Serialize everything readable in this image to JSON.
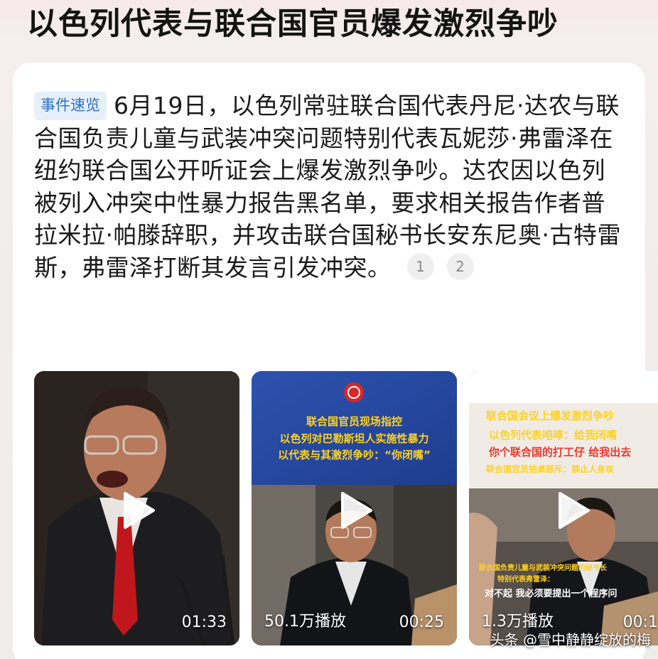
{
  "page": {
    "title": "以色列代表与联合国官员爆发激烈争吵"
  },
  "summary": {
    "tag": "事件速览",
    "text": "6月19日，以色列常驻联合国代表丹尼·达农与联合国负责儿童与武装冲突问题特别代表瓦妮莎·弗雷泽在纽约联合国公开听证会上爆发激烈争吵。达农因以色列被列入冲突中性暴力报告黑名单，要求相关报告作者普拉米拉·帕滕辞职，并攻击联合国秘书长安东尼奥·古特雷斯，弗雷泽打断其发言引发冲突。",
    "refs": [
      "1",
      "2"
    ]
  },
  "videos": [
    {
      "duration": "01:33",
      "plays": "",
      "banner": []
    },
    {
      "duration": "00:25",
      "plays": "50.1万播放",
      "banner": [
        "联合国官员现场指控",
        "以色列对巴勒斯坦人实施性暴力",
        "以代表与其激烈争吵：“你闭嘴”"
      ]
    },
    {
      "duration": "00:1",
      "plays": "1.3万播放",
      "banner": [
        "联合国会议上爆发激烈争吵",
        "以色列代表咆哮：给我闭嘴",
        "你个联合国的打工仔 给我出去",
        "联合国官员拍桌怒斥：禁止人身攻"
      ],
      "subtitle": [
        "联合国负责儿童与武装冲突问题的秘书长",
        "特别代表弗雷泽：",
        "对不起 我必须要提出一个程序问"
      ]
    }
  ],
  "watermark": "头条 @雪中静静绽放的梅",
  "colors": {
    "tag_text": "#2f6fc9",
    "tag_bg": "#e6f0fb",
    "banner_yellow": "#ffd21f",
    "banner_red": "#e83a2b"
  },
  "icons": {
    "play": "play-icon"
  }
}
